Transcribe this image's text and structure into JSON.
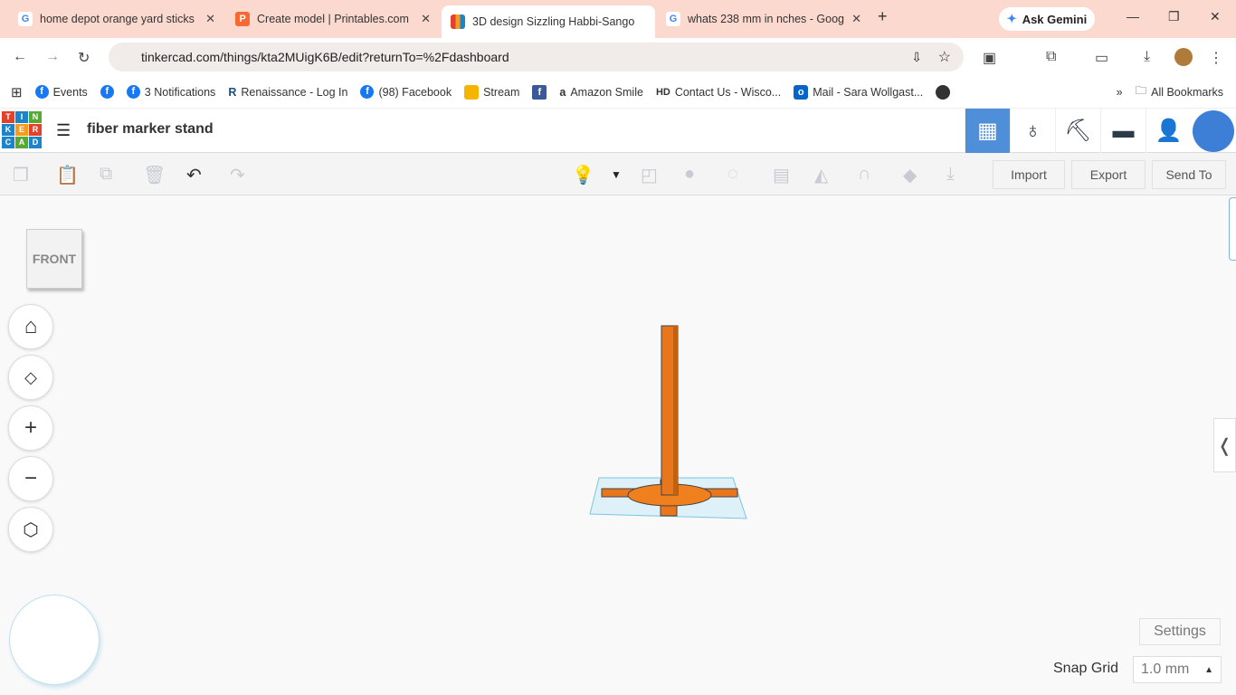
{
  "browser": {
    "tabs": [
      {
        "title": "home depot orange yard sticks",
        "icon": "google-icon"
      },
      {
        "title": "Create model | Printables.com",
        "icon": "printables-icon"
      },
      {
        "title": "3D design Sizzling Habbi-Sango",
        "icon": "tinkercad-icon"
      },
      {
        "title": "whats 238 mm in nches - Goog",
        "icon": "google-icon"
      }
    ],
    "ask_gemini": "Ask Gemini",
    "url": "tinkercad.com/things/kta2MUigK6B/edit?returnTo=%2Fdashboard",
    "bookmarks": [
      "Events",
      "",
      "3 Notifications",
      "Renaissance - Log In",
      "(98) Facebook",
      "Stream",
      "",
      "Amazon Smile",
      "Contact Us - Wisco...",
      "Mail - Sara Wollgast...",
      ""
    ],
    "all_bookmarks": "All Bookmarks"
  },
  "app": {
    "logo": [
      "T",
      "I",
      "N",
      "K",
      "E",
      "R",
      "C",
      "A",
      "D"
    ],
    "design_title": "fiber marker stand",
    "import": "Import",
    "export": "Export",
    "send_to": "Send To",
    "view_cube": "FRONT",
    "settings": "Settings",
    "snap_grid_label": "Snap Grid",
    "snap_grid_value": "1.0 mm"
  }
}
